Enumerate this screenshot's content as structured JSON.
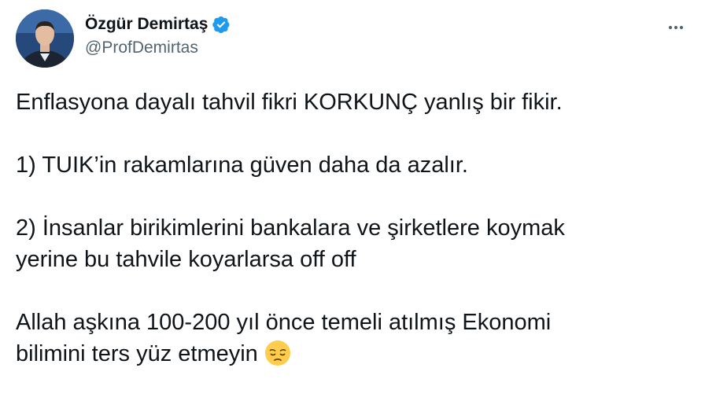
{
  "tweet": {
    "author": {
      "display_name": "Özgür Demirtaş",
      "handle": "@ProfDemirtas",
      "verified": true,
      "avatar_icon": "profile-photo"
    },
    "more_icon": "ellipsis-icon",
    "paragraphs": [
      {
        "lines": [
          "Enflasyona dayalı tahvil fikri KORKUNÇ yanlış bir fikir."
        ]
      },
      {
        "lines": [
          "1) TUIK’in rakamlarına güven daha da azalır."
        ]
      },
      {
        "lines": [
          "2) İnsanlar birikimlerini bankalara ve şirketlere koymak",
          "yerine bu tahvile koyarlarsa off off"
        ]
      },
      {
        "lines": [
          "Allah aşkına 100-200 yıl önce temeli atılmış Ekonomi",
          "bilimini ters yüz etmeyin"
        ],
        "trailing_emoji": "pensive-face-emoji"
      }
    ]
  },
  "colors": {
    "text": "#0f1419",
    "secondary": "#536471",
    "verified": "#1d9bf0"
  }
}
